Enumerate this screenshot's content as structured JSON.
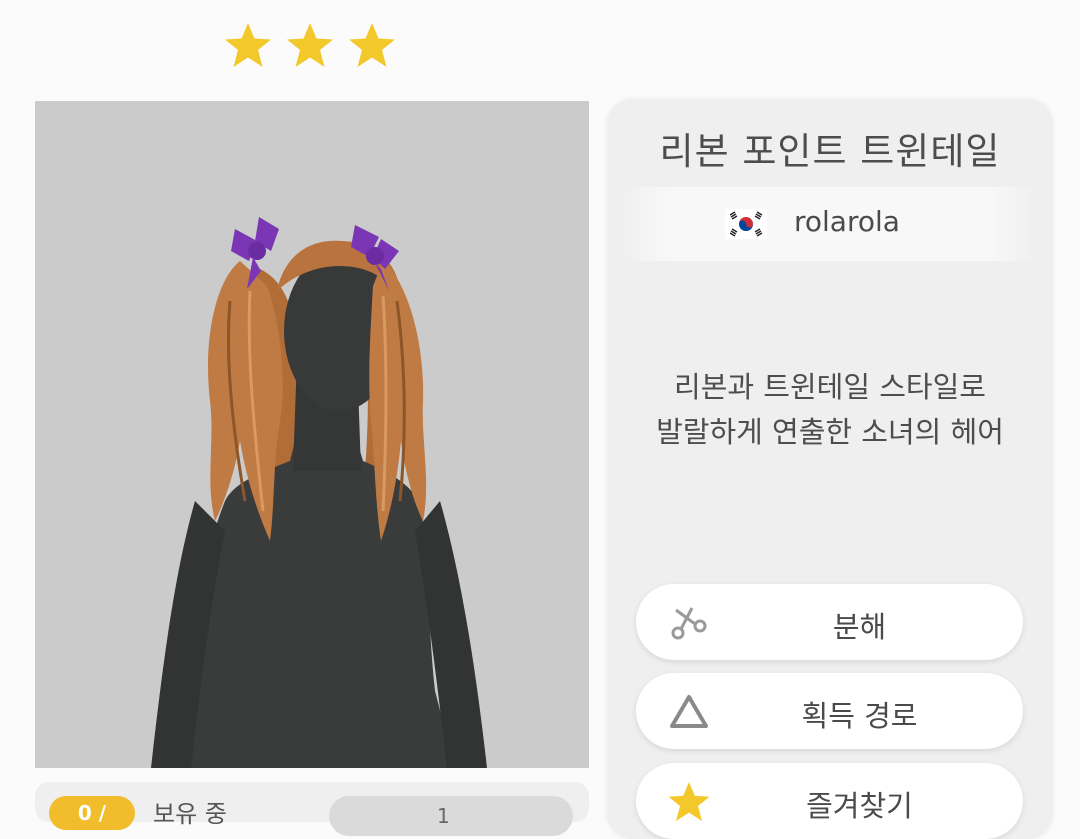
{
  "rating": {
    "stars": 3,
    "star_color": "#f3c82b"
  },
  "item": {
    "name": "리본 포인트 트윈테일",
    "creator": "rolarola",
    "creator_country_icon": "south-korea-flag-icon",
    "description_line1": "리본과 트윈테일 스타일로",
    "description_line2": "발랄하게 연출한 소녀의 헤어"
  },
  "actions": {
    "disassemble_label": "분해",
    "acquire_path_label": "획득 경로",
    "favorite_label": "즐겨찾기"
  },
  "bottom": {
    "owned_badge": "0 /",
    "owned_label": "보유 중",
    "pill_text": "1"
  },
  "colors": {
    "preview_bg": "#cbcbcb",
    "panel_bg": "#efefef",
    "accent_yellow": "#f3c82b",
    "hair": "#c07a43",
    "ribbon": "#7a36b4",
    "mannequin": "#3a3c3c"
  }
}
